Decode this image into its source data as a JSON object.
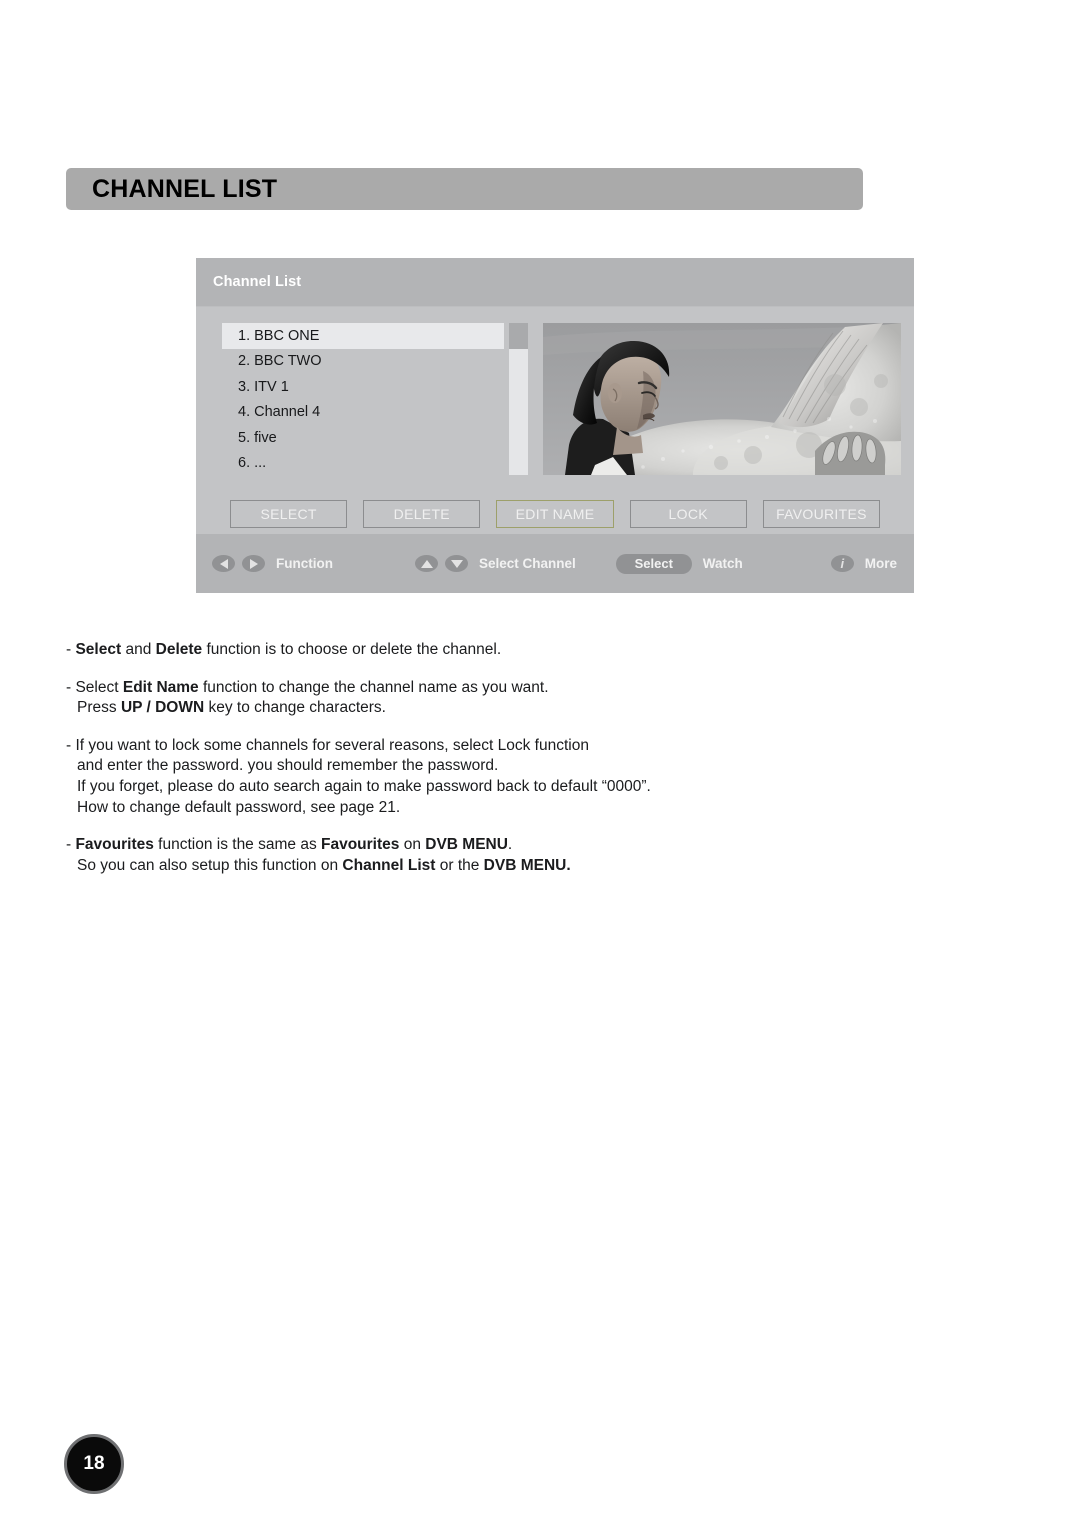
{
  "page": {
    "title": "CHANNEL LIST",
    "number": "18"
  },
  "osd": {
    "header_title": "Channel List",
    "channels": [
      {
        "label": "1. BBC ONE",
        "selected": true
      },
      {
        "label": "2. BBC TWO",
        "selected": false
      },
      {
        "label": "3. ITV 1",
        "selected": false
      },
      {
        "label": "4. Channel 4",
        "selected": false
      },
      {
        "label": "5. five",
        "selected": false
      },
      {
        "label": "6. ...",
        "selected": false
      }
    ],
    "preview_alt": "black-and-white photo of a woman beside a horse",
    "buttons": [
      {
        "label": "SELECT",
        "highlight": false
      },
      {
        "label": "DELETE",
        "highlight": false
      },
      {
        "label": "EDIT NAME",
        "highlight": true
      },
      {
        "label": "LOCK",
        "highlight": false
      },
      {
        "label": "FAVOURITES",
        "highlight": false
      }
    ],
    "nav": {
      "function_label": "Function",
      "select_channel_label": "Select Channel",
      "select_key_label": "Select",
      "watch_label": "Watch",
      "info_key_label": "i",
      "more_label": "More"
    }
  },
  "notes": [
    {
      "lines": [
        [
          {
            "t": "- ",
            "b": false
          },
          {
            "t": "Select",
            "b": true
          },
          {
            "t": " and ",
            "b": false
          },
          {
            "t": "Delete",
            "b": true
          },
          {
            "t": " function is to choose or delete the channel.",
            "b": false
          }
        ]
      ]
    },
    {
      "lines": [
        [
          {
            "t": "- Select ",
            "b": false
          },
          {
            "t": "Edit Name",
            "b": true
          },
          {
            "t": " function to change the channel name as you want.",
            "b": false
          }
        ],
        [
          {
            "t": "Press ",
            "b": false
          },
          {
            "t": "UP / DOWN",
            "b": true
          },
          {
            "t": " key to change characters.",
            "b": false
          }
        ]
      ]
    },
    {
      "lines": [
        [
          {
            "t": "- If you want to lock some channels for several reasons, select Lock function",
            "b": false
          }
        ],
        [
          {
            "t": "and enter the password. you should remember the password.",
            "b": false
          }
        ],
        [
          {
            "t": "If you forget, please do auto search again to make password back to default “0000”.",
            "b": false
          }
        ],
        [
          {
            "t": "How to change default password, see page 21.",
            "b": false
          }
        ]
      ]
    },
    {
      "lines": [
        [
          {
            "t": "- ",
            "b": false
          },
          {
            "t": "Favourites",
            "b": true
          },
          {
            "t": " function is the same as ",
            "b": false
          },
          {
            "t": "Favourites",
            "b": true
          },
          {
            "t": " on ",
            "b": false
          },
          {
            "t": "DVB MENU",
            "b": true
          },
          {
            "t": ".",
            "b": false
          }
        ],
        [
          {
            "t": "So you can also setup this function on ",
            "b": false
          },
          {
            "t": "Channel List",
            "b": true
          },
          {
            "t": " or the ",
            "b": false
          },
          {
            "t": "DVB MENU.",
            "b": true
          }
        ]
      ]
    }
  ],
  "colors": {
    "title_bar": "#aaaaaa",
    "osd_body": "#c3c4c6",
    "osd_header": "#b3b4b6",
    "selected_row": "#e8e9eb",
    "button_border": "#8c8d8f",
    "button_border_highlight": "#9da06a",
    "page_badge_bg": "#0a0a0a",
    "page_badge_ring": "#6f7072"
  }
}
